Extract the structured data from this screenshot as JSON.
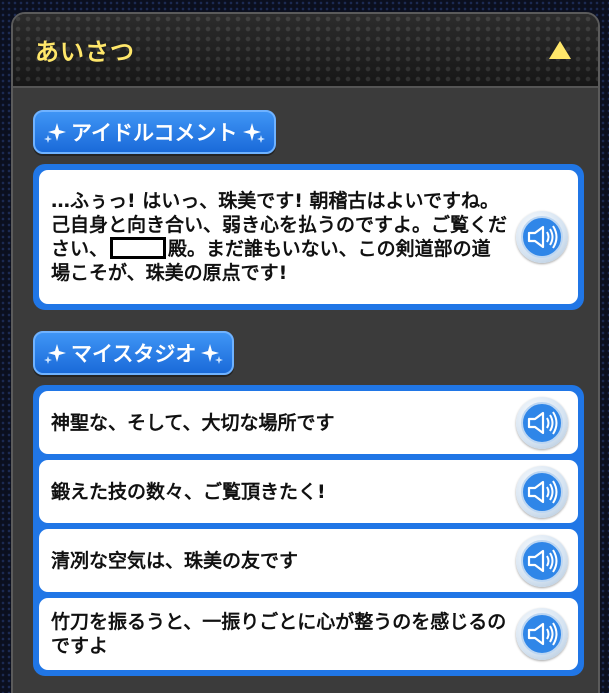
{
  "header": {
    "title": "あいさつ",
    "collapse_icon": "triangle-up-icon"
  },
  "sections": {
    "idol_comment": {
      "title": "アイドルコメント",
      "text_before": "…ふぅっ! はいっ、珠美です! 朝稽古はよいですね。己自身と向き合い、弱き心を払うのですよ。ご覧ください、",
      "text_after": "殿。まだ誰もいない、この剣道部の道場こそが、珠美の原点です!"
    },
    "my_studio": {
      "title": "マイスタジオ",
      "lines": [
        "神聖な、そして、大切な場所です",
        "鍛えた技の数々、ご覧頂きたく!",
        "清冽な空気は、珠美の友です",
        "竹刀を振るうと、一振りごとに心が整うのを感じるのですよ"
      ]
    }
  },
  "colors": {
    "title_yellow": "#ffe76a",
    "section_blue": "#2076e6",
    "panel_gray": "#3b3b3b"
  },
  "icons": {
    "voice": "speaker-voice-icon",
    "sparkle": "sparkle-star-icon"
  }
}
